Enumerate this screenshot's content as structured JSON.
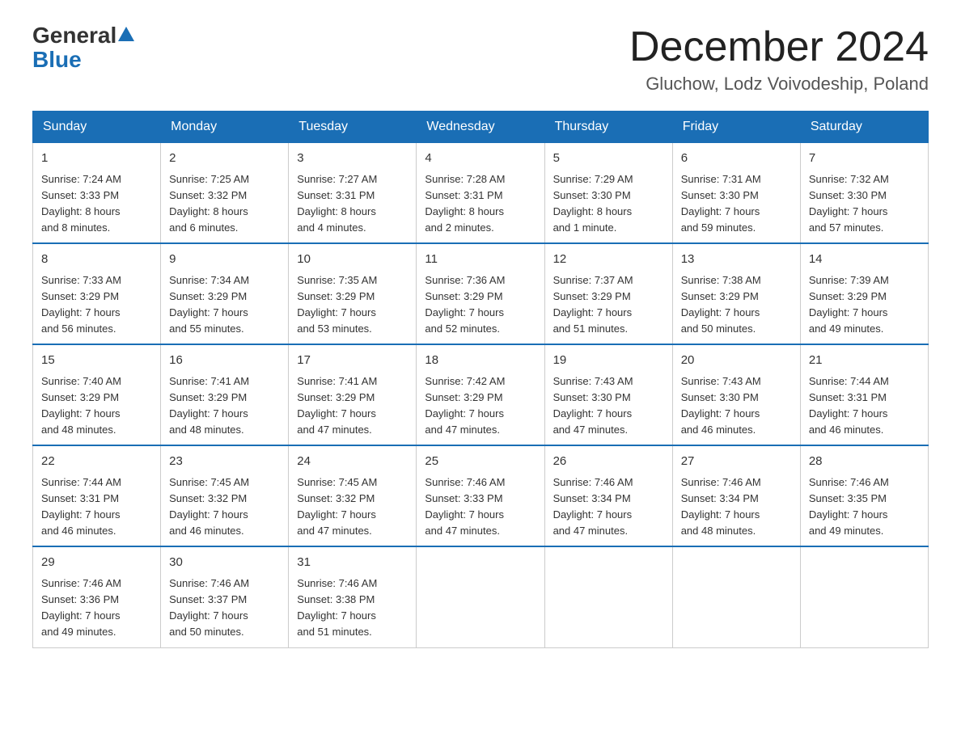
{
  "header": {
    "logo": {
      "general": "General",
      "blue": "Blue"
    },
    "title": "December 2024",
    "location": "Gluchow, Lodz Voivodeship, Poland"
  },
  "weekdays": [
    "Sunday",
    "Monday",
    "Tuesday",
    "Wednesday",
    "Thursday",
    "Friday",
    "Saturday"
  ],
  "weeks": [
    [
      {
        "day": "1",
        "sunrise": "7:24 AM",
        "sunset": "3:33 PM",
        "daylight": "8 hours and 8 minutes."
      },
      {
        "day": "2",
        "sunrise": "7:25 AM",
        "sunset": "3:32 PM",
        "daylight": "8 hours and 6 minutes."
      },
      {
        "day": "3",
        "sunrise": "7:27 AM",
        "sunset": "3:31 PM",
        "daylight": "8 hours and 4 minutes."
      },
      {
        "day": "4",
        "sunrise": "7:28 AM",
        "sunset": "3:31 PM",
        "daylight": "8 hours and 2 minutes."
      },
      {
        "day": "5",
        "sunrise": "7:29 AM",
        "sunset": "3:30 PM",
        "daylight": "8 hours and 1 minute."
      },
      {
        "day": "6",
        "sunrise": "7:31 AM",
        "sunset": "3:30 PM",
        "daylight": "7 hours and 59 minutes."
      },
      {
        "day": "7",
        "sunrise": "7:32 AM",
        "sunset": "3:30 PM",
        "daylight": "7 hours and 57 minutes."
      }
    ],
    [
      {
        "day": "8",
        "sunrise": "7:33 AM",
        "sunset": "3:29 PM",
        "daylight": "7 hours and 56 minutes."
      },
      {
        "day": "9",
        "sunrise": "7:34 AM",
        "sunset": "3:29 PM",
        "daylight": "7 hours and 55 minutes."
      },
      {
        "day": "10",
        "sunrise": "7:35 AM",
        "sunset": "3:29 PM",
        "daylight": "7 hours and 53 minutes."
      },
      {
        "day": "11",
        "sunrise": "7:36 AM",
        "sunset": "3:29 PM",
        "daylight": "7 hours and 52 minutes."
      },
      {
        "day": "12",
        "sunrise": "7:37 AM",
        "sunset": "3:29 PM",
        "daylight": "7 hours and 51 minutes."
      },
      {
        "day": "13",
        "sunrise": "7:38 AM",
        "sunset": "3:29 PM",
        "daylight": "7 hours and 50 minutes."
      },
      {
        "day": "14",
        "sunrise": "7:39 AM",
        "sunset": "3:29 PM",
        "daylight": "7 hours and 49 minutes."
      }
    ],
    [
      {
        "day": "15",
        "sunrise": "7:40 AM",
        "sunset": "3:29 PM",
        "daylight": "7 hours and 48 minutes."
      },
      {
        "day": "16",
        "sunrise": "7:41 AM",
        "sunset": "3:29 PM",
        "daylight": "7 hours and 48 minutes."
      },
      {
        "day": "17",
        "sunrise": "7:41 AM",
        "sunset": "3:29 PM",
        "daylight": "7 hours and 47 minutes."
      },
      {
        "day": "18",
        "sunrise": "7:42 AM",
        "sunset": "3:29 PM",
        "daylight": "7 hours and 47 minutes."
      },
      {
        "day": "19",
        "sunrise": "7:43 AM",
        "sunset": "3:30 PM",
        "daylight": "7 hours and 47 minutes."
      },
      {
        "day": "20",
        "sunrise": "7:43 AM",
        "sunset": "3:30 PM",
        "daylight": "7 hours and 46 minutes."
      },
      {
        "day": "21",
        "sunrise": "7:44 AM",
        "sunset": "3:31 PM",
        "daylight": "7 hours and 46 minutes."
      }
    ],
    [
      {
        "day": "22",
        "sunrise": "7:44 AM",
        "sunset": "3:31 PM",
        "daylight": "7 hours and 46 minutes."
      },
      {
        "day": "23",
        "sunrise": "7:45 AM",
        "sunset": "3:32 PM",
        "daylight": "7 hours and 46 minutes."
      },
      {
        "day": "24",
        "sunrise": "7:45 AM",
        "sunset": "3:32 PM",
        "daylight": "7 hours and 47 minutes."
      },
      {
        "day": "25",
        "sunrise": "7:46 AM",
        "sunset": "3:33 PM",
        "daylight": "7 hours and 47 minutes."
      },
      {
        "day": "26",
        "sunrise": "7:46 AM",
        "sunset": "3:34 PM",
        "daylight": "7 hours and 47 minutes."
      },
      {
        "day": "27",
        "sunrise": "7:46 AM",
        "sunset": "3:34 PM",
        "daylight": "7 hours and 48 minutes."
      },
      {
        "day": "28",
        "sunrise": "7:46 AM",
        "sunset": "3:35 PM",
        "daylight": "7 hours and 49 minutes."
      }
    ],
    [
      {
        "day": "29",
        "sunrise": "7:46 AM",
        "sunset": "3:36 PM",
        "daylight": "7 hours and 49 minutes."
      },
      {
        "day": "30",
        "sunrise": "7:46 AM",
        "sunset": "3:37 PM",
        "daylight": "7 hours and 50 minutes."
      },
      {
        "day": "31",
        "sunrise": "7:46 AM",
        "sunset": "3:38 PM",
        "daylight": "7 hours and 51 minutes."
      },
      null,
      null,
      null,
      null
    ]
  ],
  "labels": {
    "sunrise": "Sunrise:",
    "sunset": "Sunset:",
    "daylight": "Daylight:"
  }
}
